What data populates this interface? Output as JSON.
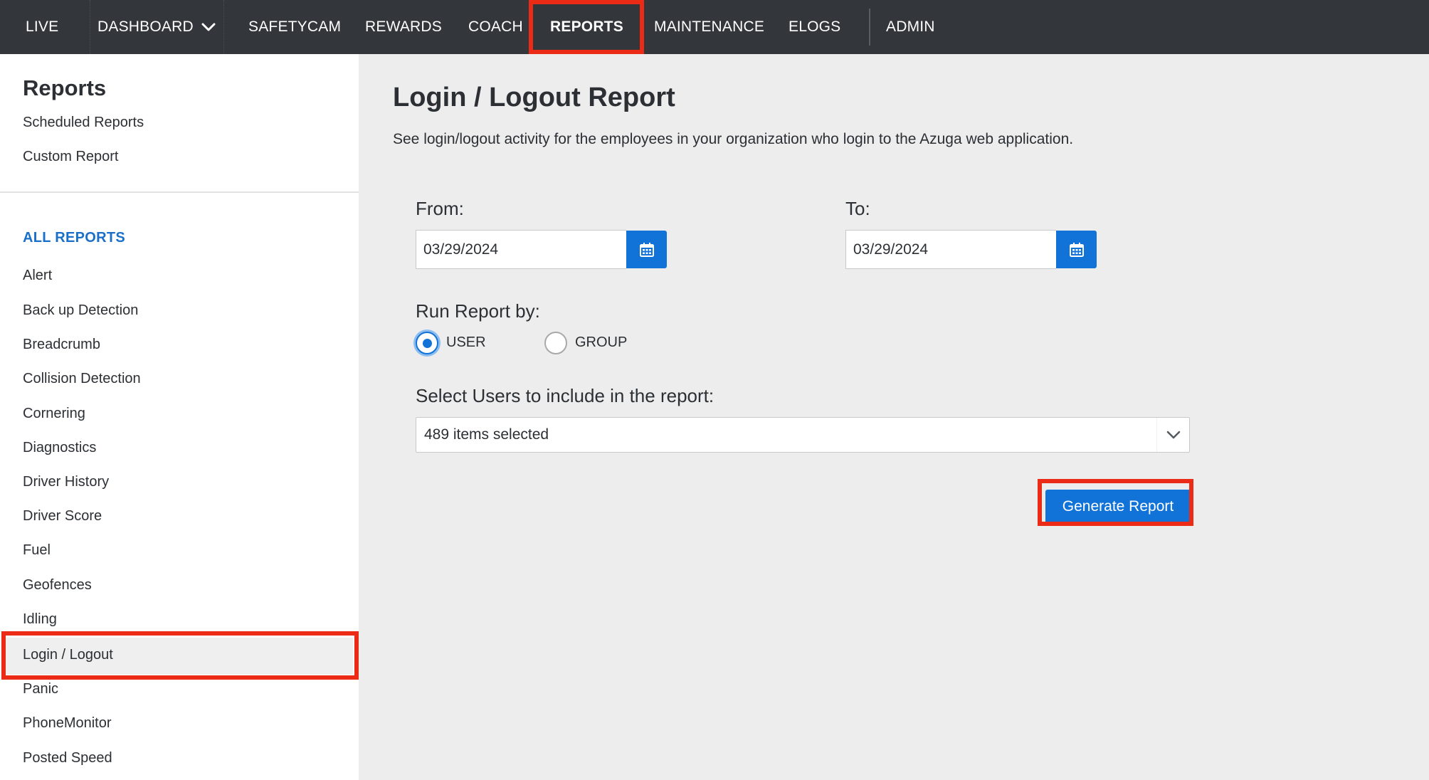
{
  "topnav": {
    "items": [
      "LIVE",
      "DASHBOARD",
      "SAFETYCAM",
      "REWARDS",
      "COACH",
      "REPORTS",
      "MAINTENANCE",
      "ELOGS",
      "ADMIN"
    ],
    "active": "REPORTS"
  },
  "sidebar": {
    "title": "Reports",
    "links": [
      "Scheduled Reports",
      "Custom Report"
    ],
    "section_title": "ALL REPORTS",
    "items": [
      "Alert",
      "Back up Detection",
      "Breadcrumb",
      "Collision Detection",
      "Cornering",
      "Diagnostics",
      "Driver History",
      "Driver Score",
      "Fuel",
      "Geofences",
      "Idling",
      "Login / Logout",
      "Panic",
      "PhoneMonitor",
      "Posted Speed"
    ],
    "selected": "Login / Logout"
  },
  "main": {
    "title": "Login / Logout Report",
    "description": "See login/logout activity for the employees in your organization who login to the Azuga web application.",
    "from_label": "From:",
    "from_value": "03/29/2024",
    "to_label": "To:",
    "to_value": "03/29/2024",
    "run_by_label": "Run Report by:",
    "run_by_options": [
      "USER",
      "GROUP"
    ],
    "run_by_selected": "USER",
    "select_users_label": "Select Users to include in the report:",
    "select_users_value": "489 items selected",
    "generate_button": "Generate Report"
  },
  "colors": {
    "nav_bg": "#33363b",
    "accent_blue": "#1173d8",
    "section_blue": "#1a70c8",
    "highlight_red": "#ec2b17",
    "content_bg": "#ededed"
  },
  "icons": {
    "calendar": "calendar-icon",
    "dropdown": "chevron-down-icon"
  }
}
